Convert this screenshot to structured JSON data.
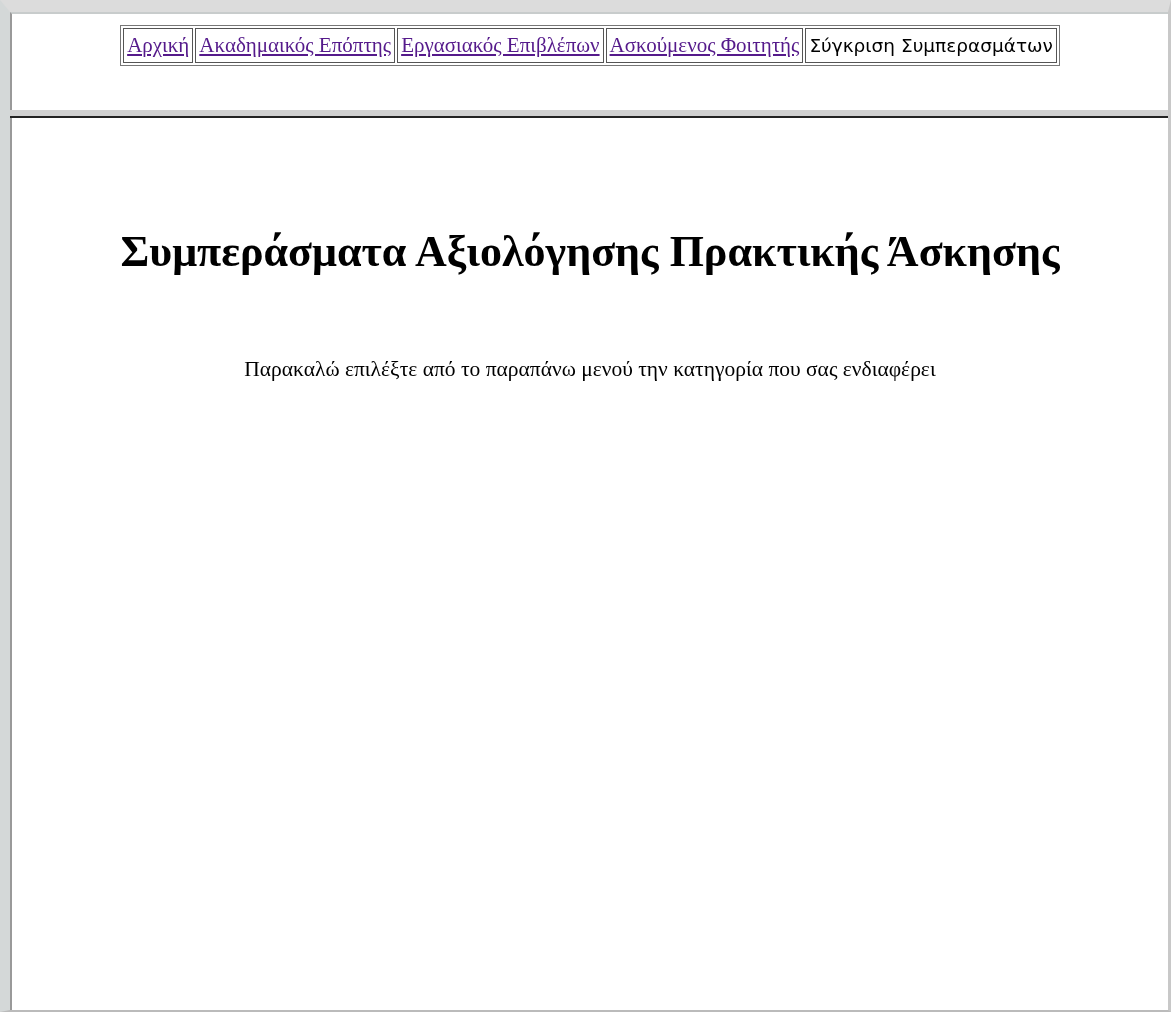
{
  "menu": [
    {
      "label": "Αρχική",
      "selected": false
    },
    {
      "label": "Ακαδημαικός Επόπτης",
      "selected": false
    },
    {
      "label": "Εργασιακός Επιβλέπων",
      "selected": false
    },
    {
      "label": "Ασκούμενος Φοιτητής",
      "selected": false
    },
    {
      "label": "Σύγκριση Συμπερασμάτων",
      "selected": true
    }
  ],
  "heading": "Συμπεράσματα Αξιολόγησης Πρακτικής Άσκησης",
  "message": "Παρακαλώ επιλέξτε από το παραπάνω μενού την κατηγορία που σας ενδιαφέρει"
}
